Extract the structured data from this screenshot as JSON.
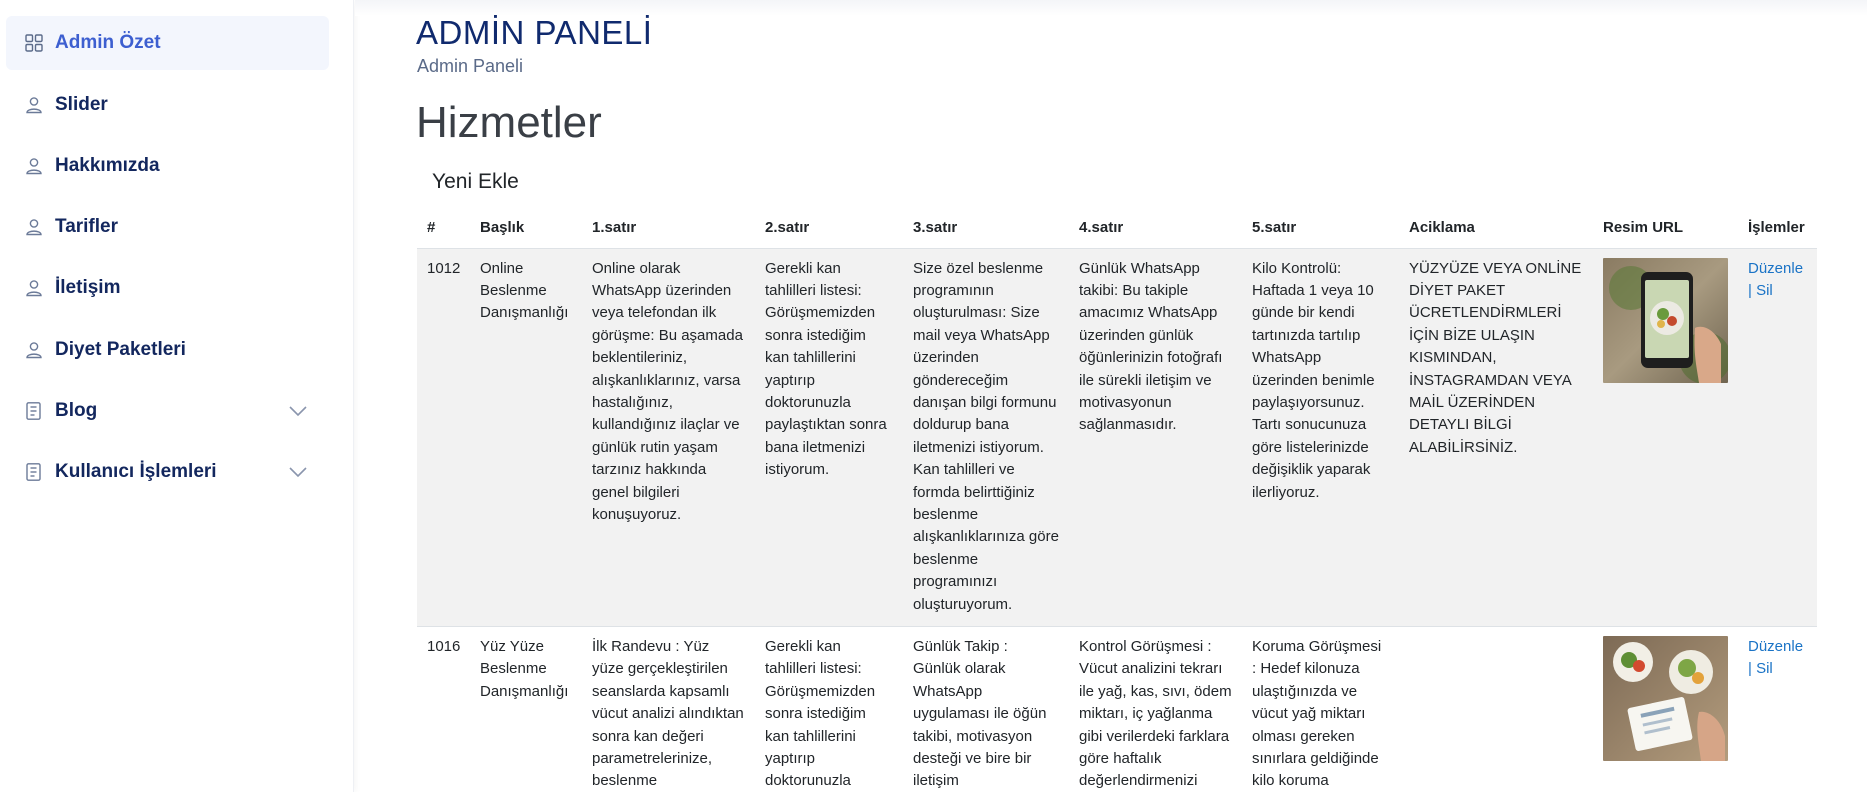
{
  "sidebar": {
    "items": [
      {
        "label": "Admin Özet"
      },
      {
        "label": "Slider"
      },
      {
        "label": "Hakkımızda"
      },
      {
        "label": "Tarifler"
      },
      {
        "label": "İletişim"
      },
      {
        "label": "Diyet Paketleri"
      },
      {
        "label": "Blog"
      },
      {
        "label": "Kullanıcı İşlemleri"
      }
    ]
  },
  "header": {
    "title": "ADMİN PANELİ",
    "subtitle": "Admin Paneli"
  },
  "page": {
    "title": "Hizmetler",
    "new_label": "Yeni Ekle"
  },
  "table": {
    "headers": [
      "#",
      "Başlık",
      "1.satır",
      "2.satır",
      "3.satır",
      "4.satır",
      "5.satır",
      "Aciklama",
      "Resim URL",
      "İşlemler"
    ],
    "edit_label": "Düzenle",
    "separator": "|",
    "delete_label": "Sil",
    "rows": [
      {
        "id": "1012",
        "title": "Online Beslenme Danışmanlığı",
        "line1": "Online olarak WhatsApp üzerinden veya telefondan ilk görüşme: Bu aşamada beklentileriniz, alışkanlıklarınız, varsa hastalığınız, kullandığınız ilaçlar ve günlük rutin yaşam tarzınız hakkında genel bilgileri konuşuyoruz.",
        "line2": "Gerekli kan tahlilleri listesi: Görüşmemizden sonra istediğim kan tahlillerini yaptırıp doktorunuzla paylaştıktan sonra bana iletmenizi istiyorum.",
        "line3": "Size özel beslenme programının oluşturulması: Size mail veya WhatsApp üzerinden göndereceğim danışan bilgi formunu doldurup bana iletmenizi istiyorum. Kan tahlilleri ve formda belirttiğiniz beslenme alışkanlıklarınıza göre beslenme programınızı oluşturuyorum.",
        "line4": "Günlük WhatsApp takibi: Bu takiple amacımız WhatsApp üzerinden günlük öğünlerinizin fotoğrafı ile sürekli iletişim ve motivasyonun sağlanmasıdır.",
        "line5": "Kilo Kontrolü: Haftada 1 veya 10 günde bir kendi tartınızda tartılıp WhatsApp üzerinden benimle paylaşıyorsunuz. Tartı sonucunuza göre listelerinizde değişiklik yaparak ilerliyoruz.",
        "description": "YÜZYÜZE VEYA ONLİNE DİYET PAKET ÜCRETLENDİRMLERİ İÇİN BİZE ULAŞIN KISMINDAN, İNSTAGRAMDAN VEYA MAİL ÜZERİNDEN DETAYLI BİLGİ ALABİLİRSİNİZ."
      },
      {
        "id": "1016",
        "title": "Yüz Yüze Beslenme Danışmanlığı",
        "line1": "İlk Randevu : Yüz yüze gerçekleştirilen seanslarda kapsamlı vücut analizi alındıktan sonra kan değeri parametrelerinize, beslenme",
        "line2": "Gerekli kan tahlilleri listesi: Görüşmemizden sonra istediğim kan tahlillerini yaptırıp doktorunuzla",
        "line3": "Günlük Takip : Günlük olarak WhatsApp uygulaması ile öğün takibi, motivasyon desteği ve bire bir iletişim",
        "line4": "Kontrol Görüşmesi : Vücut analizini tekrarı ile yağ, kas, sıvı, ödem miktarı, iç yağlanma gibi verilerdeki farklara göre haftalık değerlendirmenizi",
        "line5": "Koruma Görüşmesi : Hedef kilonuza ulaştığınızda ve vücut yağ miktarı olması gereken sınırlara geldiğinde kilo koruma",
        "description": ""
      }
    ]
  }
}
